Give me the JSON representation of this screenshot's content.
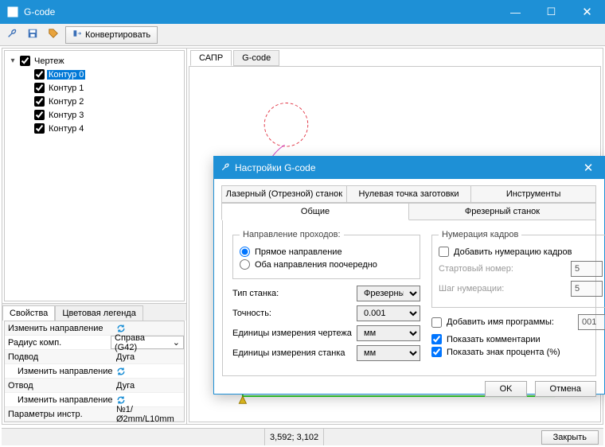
{
  "window": {
    "title": "G-code"
  },
  "toolbar": {
    "convert": "Конвертировать"
  },
  "tree": {
    "root": "Чертеж",
    "items": [
      {
        "label": "Контур 0",
        "selected": true
      },
      {
        "label": "Контур 1",
        "selected": false
      },
      {
        "label": "Контур 2",
        "selected": false
      },
      {
        "label": "Контур 3",
        "selected": false
      },
      {
        "label": "Контур 4",
        "selected": false
      }
    ]
  },
  "propsTabs": {
    "t0": "Свойства",
    "t1": "Цветовая легенда"
  },
  "props": {
    "r0k": "Изменить направление",
    "r1k": "Радиус комп.",
    "r1v": "Справа (G42)",
    "r2k": "Подвод",
    "r2v": "Дуга",
    "r3k": "Изменить направление",
    "r4k": "Отвод",
    "r4v": "Дуга",
    "r5k": "Изменить направление",
    "r6k": "Параметры инстр.",
    "r6v": "№1/Ø2mm/L10mm"
  },
  "canvasTabs": {
    "t0": "САПР",
    "t1": "G-code"
  },
  "status": {
    "coord": "3,592; 3,102",
    "close": "Закрыть"
  },
  "dialog": {
    "title": "Настройки G-code",
    "tabs": {
      "r0": [
        "Лазерный (Отрезной) станок",
        "Нулевая точка заготовки",
        "Инструменты"
      ],
      "r1": [
        "Общие",
        "Фрезерный станок"
      ]
    },
    "left": {
      "dirGroup": "Направление проходов:",
      "dir0": "Прямое направление",
      "dir1": "Оба направления поочередно",
      "typeLab": "Тип станка:",
      "typeVal": "Фрезерный",
      "precLab": "Точность:",
      "precVal": "0.001",
      "duLab": "Единицы измерения чертежа",
      "duVal": "мм",
      "muLab": "Единицы измерения станка",
      "muVal": "мм"
    },
    "right": {
      "numGroup": "Нумерация кадров",
      "addNum": "Добавить нумерацию кадров",
      "startLab": "Стартовый номер:",
      "startVal": "5",
      "stepLab": "Шаг нумерации:",
      "stepVal": "5",
      "addName": "Добавить имя программы:",
      "addNameVal": "001",
      "showComm": "Показать комментарии",
      "showPct": "Показать знак процента (%)"
    },
    "ok": "OK",
    "cancel": "Отмена"
  }
}
